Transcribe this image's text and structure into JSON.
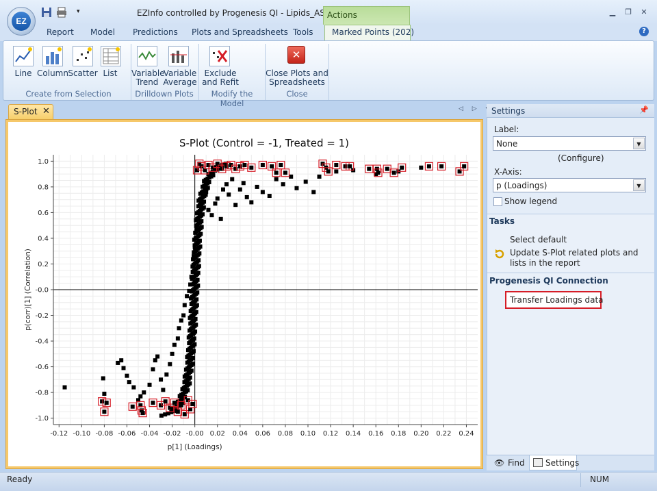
{
  "window": {
    "title": "EZInfo controlled by Progenesis QI - Lipids_ASMS",
    "logo_text": "EZ",
    "contextual_group": "Actions"
  },
  "ribbon_tabs": [
    "Report",
    "Model",
    "Predictions",
    "Plots and Spreadsheets",
    "Tools",
    "Marked Points (202)"
  ],
  "ribbon": {
    "group_create": {
      "label": "Create from Selection",
      "buttons": [
        "Line",
        "Column",
        "Scatter",
        "List"
      ]
    },
    "group_drilldown": {
      "label": "Drilldown Plots",
      "buttons": [
        "Variable\nTrend",
        "Variable\nAverage"
      ]
    },
    "group_model": {
      "label": "Modify the Model",
      "buttons": [
        "Exclude\nand Refit"
      ]
    },
    "group_close": {
      "label": "Close",
      "buttons": [
        "Close Plots and\nSpreadsheets"
      ]
    }
  },
  "document_tab": {
    "label": "S-Plot",
    "close": "✕"
  },
  "doc_nav": "◁ ▷ ▾",
  "chart_data": {
    "type": "scatter",
    "title": "S-Plot (Control = -1, Treated = 1)",
    "xlabel": "p[1] (Loadings)",
    "ylabel": "p(corr)[1] (Correlation)",
    "xlim": [
      -0.125,
      0.25
    ],
    "ylim": [
      -1.05,
      1.05
    ],
    "xticks": [
      -0.12,
      -0.1,
      -0.08,
      -0.06,
      -0.04,
      -0.02,
      -0.0,
      0.02,
      0.04,
      0.06,
      0.08,
      0.1,
      0.12,
      0.14,
      0.16,
      0.18,
      0.2,
      0.22,
      0.24
    ],
    "xtick_labels": [
      "-0.12",
      "-0.10",
      "-0.08",
      "-0.06",
      "-0.04",
      "-0.02",
      "-0.00",
      "0.02",
      "0.04",
      "0.06",
      "0.08",
      "0.10",
      "0.12",
      "0.14",
      "0.16",
      "0.18",
      "0.20",
      "0.22",
      "0.24"
    ],
    "yticks": [
      1.0,
      0.8,
      0.6,
      0.4,
      0.2,
      0.0,
      -0.2,
      -0.4,
      -0.6,
      -0.8,
      -1.0
    ],
    "ytick_labels": [
      "1.0",
      "0.8",
      "0.6",
      "0.4",
      "0.2",
      "-0.0",
      "-0.2",
      "-0.4",
      "-0.6",
      "-0.8",
      "-1.0"
    ],
    "grid": true,
    "marked_count": 202,
    "series": [
      {
        "marker": "square",
        "color": "#000000",
        "points": [
          [
            -0.115,
            -0.76
          ],
          [
            -0.081,
            -0.69
          ],
          [
            -0.08,
            -0.81
          ],
          [
            -0.068,
            -0.57
          ],
          [
            -0.065,
            -0.55
          ],
          [
            -0.063,
            -0.61
          ],
          [
            -0.06,
            -0.67
          ],
          [
            -0.058,
            -0.72
          ],
          [
            -0.054,
            -0.76
          ],
          [
            -0.05,
            -0.86
          ],
          [
            -0.048,
            -0.83
          ],
          [
            -0.045,
            -0.8
          ],
          [
            -0.04,
            -0.74
          ],
          [
            -0.037,
            -0.62
          ],
          [
            -0.035,
            -0.55
          ],
          [
            -0.033,
            -0.52
          ],
          [
            -0.03,
            -0.7
          ],
          [
            -0.028,
            -0.78
          ],
          [
            -0.025,
            -0.66
          ],
          [
            -0.022,
            -0.58
          ],
          [
            -0.02,
            -0.5
          ],
          [
            -0.018,
            -0.43
          ],
          [
            -0.015,
            -0.38
          ],
          [
            -0.014,
            -0.3
          ],
          [
            -0.012,
            -0.24
          ],
          [
            -0.01,
            -0.2
          ],
          [
            -0.009,
            -0.12
          ],
          [
            -0.007,
            -0.05
          ],
          [
            -0.005,
            -0.01
          ],
          [
            -0.004,
            0.04
          ],
          [
            -0.003,
            0.1
          ],
          [
            -0.002,
            0.18
          ],
          [
            -0.001,
            0.26
          ],
          [
            0.0,
            0.33
          ],
          [
            0.001,
            0.4
          ],
          [
            0.002,
            0.47
          ],
          [
            0.003,
            0.55
          ],
          [
            0.004,
            0.6
          ],
          [
            0.005,
            0.66
          ],
          [
            0.006,
            0.7
          ],
          [
            0.008,
            0.73
          ],
          [
            0.01,
            0.76
          ],
          [
            0.012,
            0.62
          ],
          [
            0.015,
            0.58
          ],
          [
            0.018,
            0.67
          ],
          [
            0.02,
            0.71
          ],
          [
            0.023,
            0.55
          ],
          [
            0.025,
            0.78
          ],
          [
            0.028,
            0.82
          ],
          [
            0.03,
            0.74
          ],
          [
            0.033,
            0.86
          ],
          [
            0.036,
            0.66
          ],
          [
            0.04,
            0.78
          ],
          [
            0.043,
            0.83
          ],
          [
            0.046,
            0.72
          ],
          [
            0.05,
            0.68
          ],
          [
            0.055,
            0.8
          ],
          [
            0.06,
            0.76
          ],
          [
            0.066,
            0.73
          ],
          [
            0.072,
            0.86
          ],
          [
            0.078,
            0.82
          ],
          [
            0.085,
            0.88
          ],
          [
            0.09,
            0.79
          ],
          [
            0.098,
            0.84
          ],
          [
            0.105,
            0.76
          ],
          [
            0.11,
            0.88
          ],
          [
            0.125,
            0.92
          ],
          [
            0.14,
            0.93
          ],
          [
            0.16,
            0.9
          ],
          [
            0.18,
            0.92
          ],
          [
            0.2,
            0.95
          ]
        ]
      },
      {
        "marker": "square-marked",
        "color": "#d51d27",
        "points": [
          [
            -0.082,
            -0.87
          ],
          [
            -0.078,
            -0.88
          ],
          [
            -0.08,
            -0.95
          ],
          [
            -0.055,
            -0.91
          ],
          [
            -0.048,
            -0.9
          ],
          [
            -0.047,
            -0.94
          ],
          [
            -0.046,
            -0.96
          ],
          [
            -0.037,
            -0.88
          ],
          [
            -0.03,
            -0.9
          ],
          [
            -0.026,
            -0.87
          ],
          [
            -0.022,
            -0.92
          ],
          [
            -0.018,
            -0.88
          ],
          [
            -0.015,
            -0.95
          ],
          [
            -0.012,
            -0.9
          ],
          [
            -0.009,
            -0.97
          ],
          [
            -0.006,
            -0.86
          ],
          [
            -0.004,
            -0.93
          ],
          [
            -0.002,
            -0.89
          ],
          [
            0.002,
            0.93
          ],
          [
            0.004,
            0.98
          ],
          [
            0.006,
            0.96
          ],
          [
            0.009,
            0.93
          ],
          [
            0.012,
            0.97
          ],
          [
            0.016,
            0.95
          ],
          [
            0.02,
            0.98
          ],
          [
            0.024,
            0.94
          ],
          [
            0.028,
            0.96
          ],
          [
            0.032,
            0.97
          ],
          [
            0.036,
            0.94
          ],
          [
            0.04,
            0.96
          ],
          [
            0.044,
            0.97
          ],
          [
            0.05,
            0.95
          ],
          [
            0.06,
            0.97
          ],
          [
            0.068,
            0.96
          ],
          [
            0.072,
            0.91
          ],
          [
            0.076,
            0.97
          ],
          [
            0.08,
            0.91
          ],
          [
            0.113,
            0.98
          ],
          [
            0.116,
            0.95
          ],
          [
            0.118,
            0.92
          ],
          [
            0.125,
            0.97
          ],
          [
            0.133,
            0.96
          ],
          [
            0.137,
            0.96
          ],
          [
            0.154,
            0.94
          ],
          [
            0.161,
            0.94
          ],
          [
            0.162,
            0.91
          ],
          [
            0.17,
            0.94
          ],
          [
            0.176,
            0.91
          ],
          [
            0.183,
            0.95
          ],
          [
            0.207,
            0.96
          ],
          [
            0.218,
            0.96
          ],
          [
            0.234,
            0.92
          ],
          [
            0.238,
            0.96
          ]
        ]
      }
    ]
  },
  "settings_panel": {
    "title": "Settings",
    "label_caption": "Label:",
    "label_value": "None",
    "configure_link": "(Configure)",
    "xaxis_caption": "X-Axis:",
    "xaxis_value": "p (Loadings)",
    "show_legend": "Show legend",
    "tasks_header": "Tasks",
    "task_select_default": "Select default",
    "task_update": "Update S-Plot related plots and lists in the report",
    "progenesis_header": "Progenesis QI Connection",
    "transfer_link": "Transfer Loadings data"
  },
  "bottom_tabs": {
    "find": "Find",
    "settings": "Settings"
  },
  "status": {
    "left": "Ready",
    "num": "NUM"
  },
  "colors": {
    "accent": "#d51d27",
    "frame": "#f6c86a",
    "actions_green": "#b9dd9a"
  }
}
